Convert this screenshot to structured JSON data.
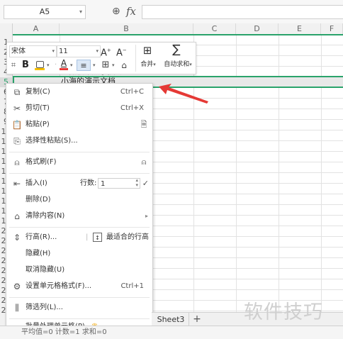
{
  "formula_bar": {
    "cell_ref": "A5",
    "fx_label": "fx",
    "formula_value": ""
  },
  "columns": [
    "A",
    "B",
    "C",
    "D",
    "E",
    "F"
  ],
  "rows": [
    "1",
    "2",
    "3",
    "4",
    "5",
    "6",
    "7",
    "8",
    "9",
    "10",
    "11",
    "12",
    "13",
    "14",
    "15",
    "16",
    "17",
    "18",
    "19",
    "20",
    "21",
    "22",
    "23",
    "24",
    "25",
    "26",
    "27",
    "28"
  ],
  "cells": {
    "b4": "1.微软雅黑小技巧",
    "b5": "小海的演示文档"
  },
  "mini_toolbar": {
    "font_name": "宋体",
    "font_size": "11",
    "bold": "B",
    "font_color": "A",
    "merge_label": "合并",
    "autosum_label": "自动求和"
  },
  "context_menu": {
    "copy": {
      "label": "复制(C)",
      "shortcut": "Ctrl+C"
    },
    "cut": {
      "label": "剪切(T)",
      "shortcut": "Ctrl+X"
    },
    "paste": {
      "label": "粘贴(P)"
    },
    "paste_special": {
      "label": "选择性粘贴(S)..."
    },
    "format_painter": {
      "label": "格式刷(F)"
    },
    "insert": {
      "label": "插入(I)",
      "rows_label": "行数:",
      "rows_value": "1"
    },
    "delete": {
      "label": "删除(D)"
    },
    "clear": {
      "label": "清除内容(N)"
    },
    "row_height": {
      "label": "行高(R)...",
      "best_fit": "最适合的行高"
    },
    "hide": {
      "label": "隐藏(H)"
    },
    "unhide": {
      "label": "取消隐藏(U)"
    },
    "format_cells": {
      "label": "设置单元格格式(F)...",
      "shortcut": "Ctrl+1"
    },
    "filter": {
      "label": "筛选列(L)..."
    },
    "batch": {
      "label": "批量处理单元格(P)"
    }
  },
  "sheet_tabs": {
    "sheet3": "Sheet3",
    "add": "+"
  },
  "status_bar": {
    "text": "平均值=0  计数=1  求和=0"
  },
  "watermark": "软件技巧",
  "colors": {
    "selection_green": "#2aa36b",
    "arrow_red": "#e53935",
    "font_color_red": "#e53935",
    "highlight_yellow": "#f6c000"
  }
}
